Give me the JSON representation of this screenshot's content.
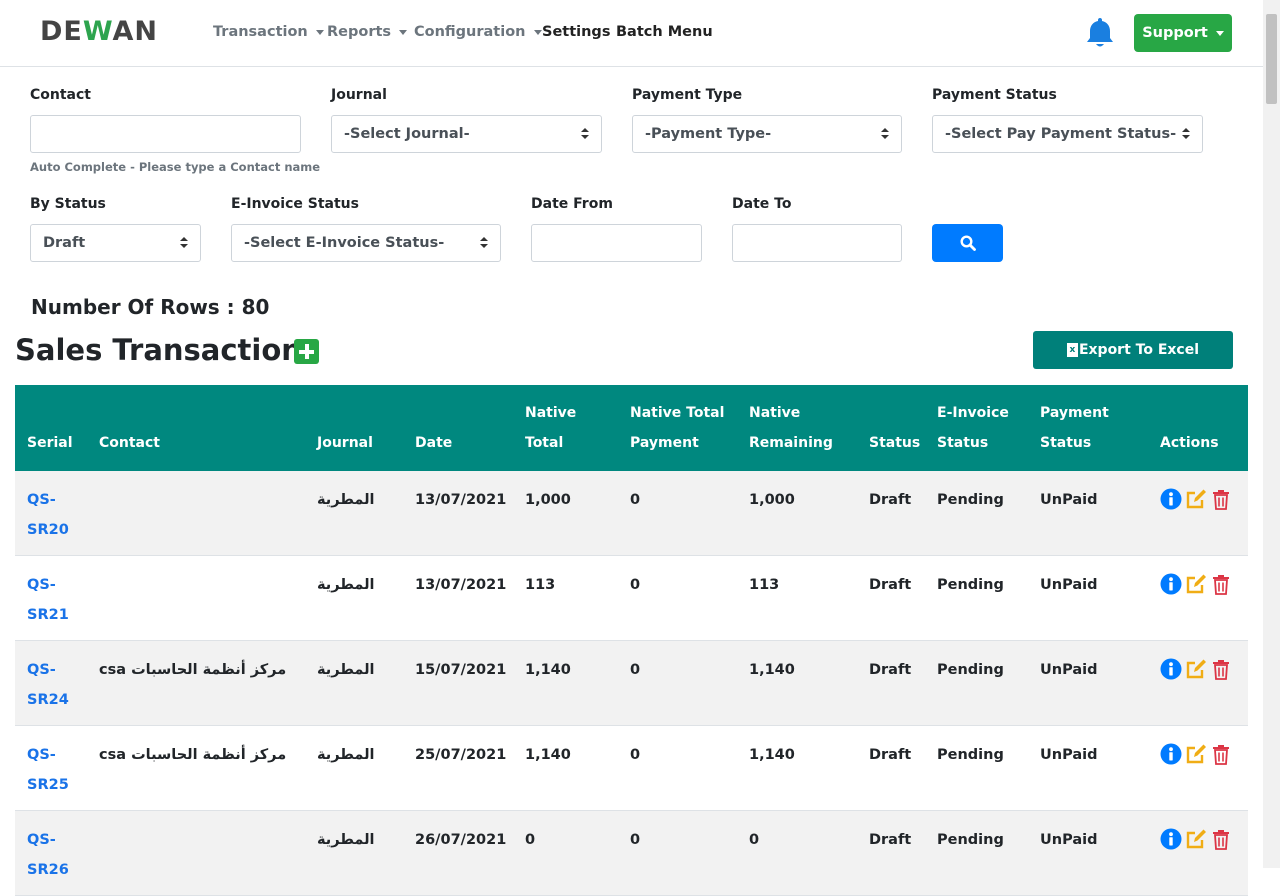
{
  "brand": {
    "logo_left": "DE",
    "logo_mid": "W",
    "logo_right": "AN"
  },
  "nav": {
    "transaction": "Transaction",
    "reports": "Reports",
    "configuration": "Configuration",
    "settings": "Settings",
    "batch_menu": "Batch Menu",
    "support": "Support"
  },
  "filters": {
    "contact_label": "Contact",
    "contact_hint": "Auto Complete - Please type a Contact name",
    "journal_label": "Journal",
    "journal_value": "-Select Journal-",
    "payment_type_label": "Payment Type",
    "payment_type_value": "-Payment Type-",
    "payment_status_label": "Payment Status",
    "payment_status_value": "-Select Pay Payment Status-",
    "by_status_label": "By Status",
    "by_status_value": "Draft",
    "einvoice_label": "E-Invoice Status",
    "einvoice_value": "-Select E-Invoice Status-",
    "date_from_label": "Date From",
    "date_to_label": "Date To"
  },
  "summary": {
    "rows_count": "Number Of Rows : 80"
  },
  "page": {
    "title": "Sales Transactions",
    "export_label": "Export To Excel",
    "excel_icon_letter": "x"
  },
  "table": {
    "headers": {
      "serial": "Serial",
      "contact": "Contact",
      "journal": "Journal",
      "date": "Date",
      "native_total": "Native Total",
      "native_total_payment": "Native Total Payment",
      "native_remaining": "Native Remaining",
      "status": "Status",
      "einvoice_status": "E-Invoice Status",
      "payment_status": "Payment Status",
      "actions": "Actions"
    },
    "rows": [
      {
        "serial": "QS-SR20",
        "contact": "",
        "journal": "المطرية",
        "date": "13/07/2021",
        "native_total": "1,000",
        "total_payment": "0",
        "remaining": "1,000",
        "status": "Draft",
        "einvoice": "Pending",
        "payment": "UnPaid"
      },
      {
        "serial": "QS-SR21",
        "contact": "",
        "journal": "المطرية",
        "date": "13/07/2021",
        "native_total": "113",
        "total_payment": "0",
        "remaining": "113",
        "status": "Draft",
        "einvoice": "Pending",
        "payment": "UnPaid"
      },
      {
        "serial": "QS-SR24",
        "contact": "csa مركز أنظمة الحاسبات",
        "journal": "المطرية",
        "date": "15/07/2021",
        "native_total": "1,140",
        "total_payment": "0",
        "remaining": "1,140",
        "status": "Draft",
        "einvoice": "Pending",
        "payment": "UnPaid"
      },
      {
        "serial": "QS-SR25",
        "contact": "csa مركز أنظمة الحاسبات",
        "journal": "المطرية",
        "date": "25/07/2021",
        "native_total": "1,140",
        "total_payment": "0",
        "remaining": "1,140",
        "status": "Draft",
        "einvoice": "Pending",
        "payment": "UnPaid"
      },
      {
        "serial": "QS-SR26",
        "contact": "",
        "journal": "المطرية",
        "date": "26/07/2021",
        "native_total": "0",
        "total_payment": "0",
        "remaining": "0",
        "status": "Draft",
        "einvoice": "Pending",
        "payment": "UnPaid"
      }
    ]
  },
  "icons": {
    "bell": "bell-icon",
    "search": "search-icon",
    "add": "plus-square-icon",
    "excel": "excel-icon",
    "info": "info-circle-icon",
    "edit": "edit-icon",
    "delete": "trash-icon"
  },
  "colors": {
    "table_header": "#00887f",
    "export_button": "#00807a",
    "support_button": "#28a745",
    "search_button": "#007bff",
    "serial_link": "#1a73e8",
    "info_icon": "#007bff",
    "edit_icon": "#f0ad15",
    "delete_icon": "#dc3545"
  }
}
